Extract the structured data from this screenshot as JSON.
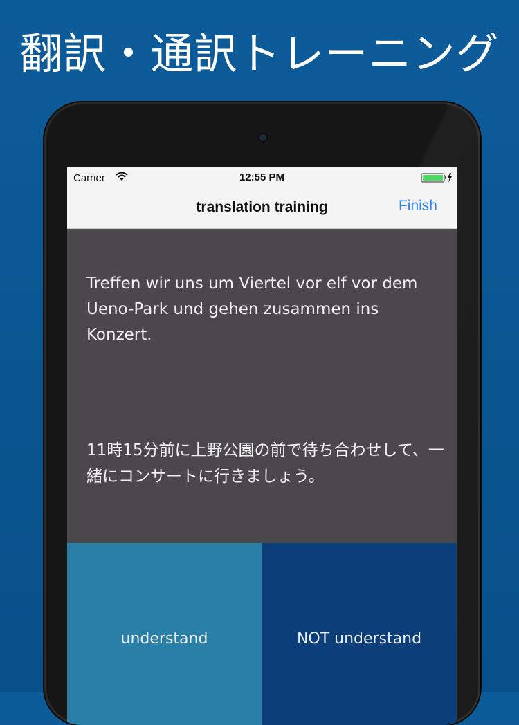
{
  "headline": "翻訳・通訳トレーニング",
  "status_bar": {
    "carrier": "Carrier",
    "time": "12:55 PM"
  },
  "nav": {
    "title": "translation training",
    "finish_label": "Finish"
  },
  "card": {
    "source_text": "Treffen wir uns um Viertel vor elf vor dem Ueno-Park und gehen zusammen ins Konzert.",
    "translation_text": "11時15分前に上野公園の前で待ち合わせして、一緒にコンサートに行きましょう。"
  },
  "buttons": {
    "understand_label": "understand",
    "not_understand_label": "NOT understand"
  },
  "colors": {
    "background": "#0a5590",
    "screen": "#4a484b",
    "understand": "#2a7fa6",
    "not_understand": "#0c3f7a",
    "accent": "#2f7ff2",
    "battery": "#4cd964"
  },
  "icons": [
    "wifi-icon",
    "battery-icon",
    "charging-bolt-icon"
  ]
}
